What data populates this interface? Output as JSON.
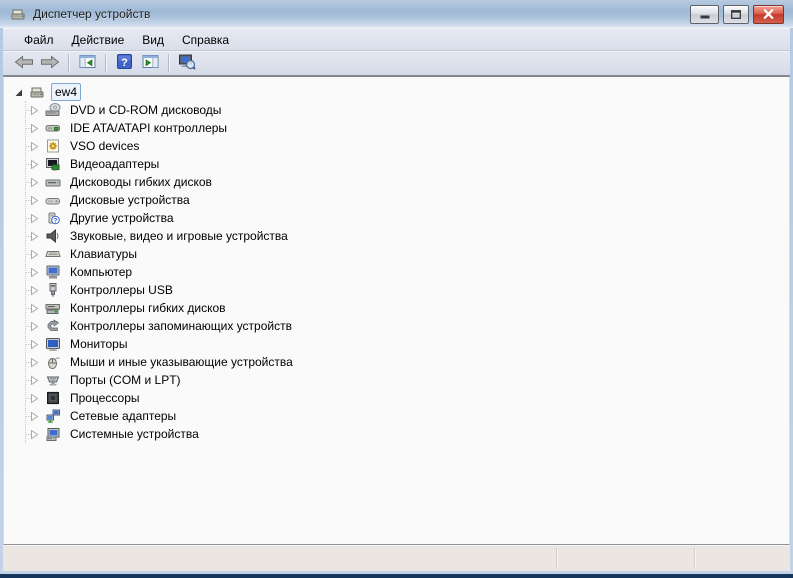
{
  "window": {
    "title": "Диспетчер устройств",
    "icon": "device-manager-icon",
    "buttons": [
      {
        "name": "minimize",
        "icon": "minimize-icon"
      },
      {
        "name": "maximize",
        "icon": "maximize-icon"
      },
      {
        "name": "close",
        "icon": "close-icon"
      }
    ]
  },
  "menu": {
    "items": [
      {
        "name": "file",
        "label": "Файл"
      },
      {
        "name": "action",
        "label": "Действие"
      },
      {
        "name": "view",
        "label": "Вид"
      },
      {
        "name": "help",
        "label": "Справка"
      }
    ]
  },
  "toolbar": {
    "buttons": [
      {
        "name": "back",
        "icon": "arrow-left-icon"
      },
      {
        "name": "forward",
        "icon": "arrow-right-icon"
      },
      {
        "name": "separator"
      },
      {
        "name": "show-console-tree",
        "icon": "console-tree-icon"
      },
      {
        "name": "separator"
      },
      {
        "name": "help",
        "icon": "help-icon"
      },
      {
        "name": "show-action-pane",
        "icon": "action-pane-icon"
      },
      {
        "name": "separator"
      },
      {
        "name": "scan-hardware-changes",
        "icon": "scan-hardware-icon"
      }
    ]
  },
  "tree": {
    "root": {
      "label": "ew4",
      "icon": "computer-root-icon",
      "state": "expanded",
      "selected": true
    },
    "items": [
      {
        "label": "DVD и CD-ROM дисководы",
        "icon": "dvd-drive-icon",
        "state": "collapsed"
      },
      {
        "label": "IDE ATA/ATAPI контроллеры",
        "icon": "ide-controller-icon",
        "state": "collapsed"
      },
      {
        "label": "VSO devices",
        "icon": "vso-gear-icon",
        "state": "collapsed"
      },
      {
        "label": "Видеоадаптеры",
        "icon": "video-adapter-icon",
        "state": "collapsed"
      },
      {
        "label": "Дисководы гибких дисков",
        "icon": "floppy-drive-icon",
        "state": "collapsed"
      },
      {
        "label": "Дисковые устройства",
        "icon": "disk-drive-icon",
        "state": "collapsed"
      },
      {
        "label": "Другие устройства",
        "icon": "unknown-device-icon",
        "state": "collapsed"
      },
      {
        "label": "Звуковые, видео и игровые устройства",
        "icon": "speaker-icon",
        "state": "collapsed"
      },
      {
        "label": "Клавиатуры",
        "icon": "keyboard-icon",
        "state": "collapsed"
      },
      {
        "label": "Компьютер",
        "icon": "computer-icon",
        "state": "collapsed"
      },
      {
        "label": "Контроллеры USB",
        "icon": "usb-icon",
        "state": "collapsed"
      },
      {
        "label": "Контроллеры гибких дисков",
        "icon": "floppy-controller-icon",
        "state": "collapsed"
      },
      {
        "label": "Контроллеры запоминающих устройств",
        "icon": "storage-controller-icon",
        "state": "collapsed"
      },
      {
        "label": "Мониторы",
        "icon": "monitor-icon",
        "state": "collapsed"
      },
      {
        "label": "Мыши и иные указывающие устройства",
        "icon": "mouse-icon",
        "state": "collapsed"
      },
      {
        "label": "Порты (COM и LPT)",
        "icon": "port-icon",
        "state": "collapsed"
      },
      {
        "label": "Процессоры",
        "icon": "cpu-icon",
        "state": "collapsed"
      },
      {
        "label": "Сетевые адаптеры",
        "icon": "network-adapter-icon",
        "state": "collapsed"
      },
      {
        "label": "Системные устройства",
        "icon": "system-device-icon",
        "state": "collapsed"
      }
    ]
  },
  "statusbar": {
    "sections": [
      "",
      "",
      ""
    ]
  },
  "colors": {
    "titlebar_top": "#9fb9d5",
    "titlebar_bottom": "#cfdcec",
    "chrome": "#dce1ed",
    "content_bg": "#fafafa",
    "selection_border": "#7fa8d4",
    "selection_fill": "#ecf3fb",
    "close_button": "#c43a2a",
    "status_bar": "#ece6e3",
    "window_border": "#bdd2e8",
    "bottom_edge": "#16365c"
  }
}
